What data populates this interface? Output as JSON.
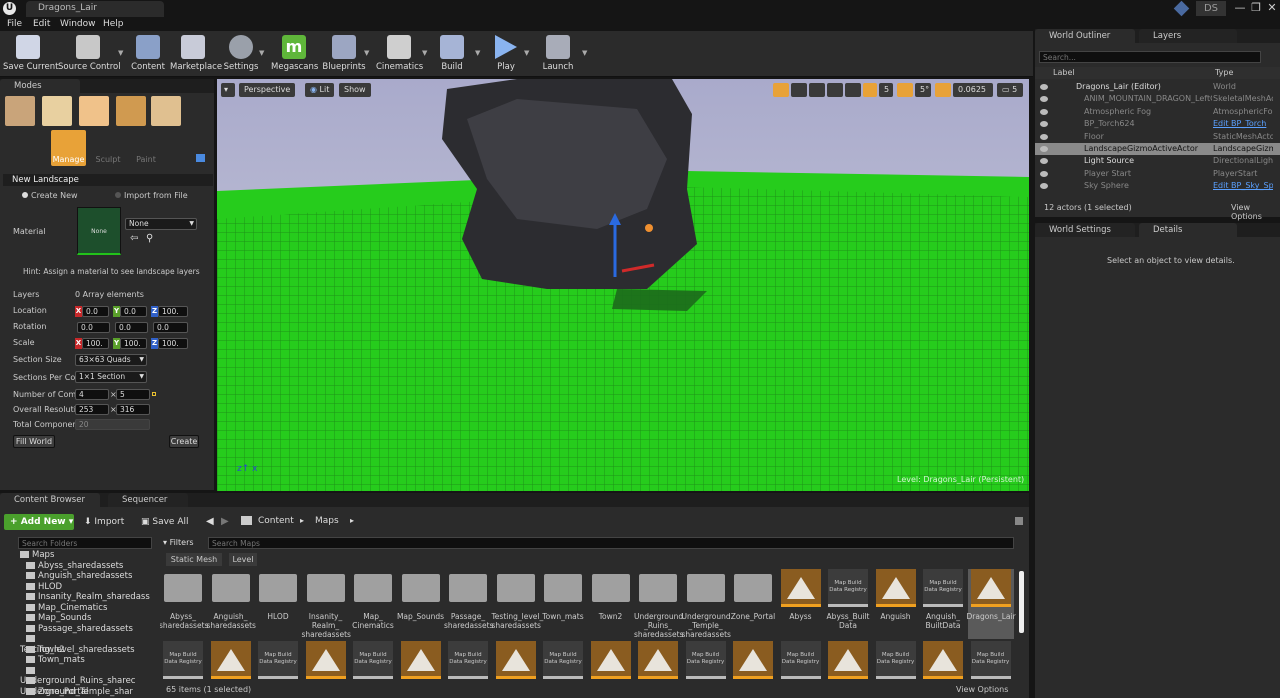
{
  "app": {
    "window_title": "Dragons_Lair",
    "logo_text": "U",
    "user_badge": "DS",
    "window_buttons": [
      "—",
      "❐",
      "✕"
    ]
  },
  "menu": [
    "File",
    "Edit",
    "Window",
    "Help"
  ],
  "toolbar": [
    {
      "label": "Save Current",
      "icon": "save-icon",
      "color": "#d0d6e6"
    },
    {
      "label": "Source Control",
      "icon": "source-control-icon",
      "color": "#c8c8c8"
    },
    {
      "label": "Content",
      "icon": "content-icon",
      "color": "#8aa0c8"
    },
    {
      "label": "Marketplace",
      "icon": "marketplace-icon",
      "color": "#c8cbd8"
    },
    {
      "label": "Settings",
      "icon": "gear-icon",
      "color": "#9aa0aa"
    },
    {
      "label": "Megascans",
      "icon": "megascans-icon",
      "color": "#5fb63a"
    },
    {
      "label": "Blueprints",
      "icon": "blueprints-icon",
      "color": "#9ca6c2"
    },
    {
      "label": "Cinematics",
      "icon": "cinematics-icon",
      "color": "#cfcfcf"
    },
    {
      "label": "Build",
      "icon": "build-icon",
      "color": "#a6b4d6"
    },
    {
      "label": "Play",
      "icon": "play-icon",
      "color": "#8ab4f0"
    },
    {
      "label": "Launch",
      "icon": "launch-icon",
      "color": "#a8acb8"
    }
  ],
  "modes": {
    "tab_label": "Modes",
    "tools": [
      "Manage",
      "Sculpt",
      "Paint"
    ],
    "section_title": "New Landscape",
    "radio_create": "Create New",
    "radio_import": "Import from File",
    "material_label": "Material",
    "material_thumb": "None",
    "material_value": "None",
    "hint": "Hint: Assign a material to see landscape layers",
    "layers_label": "Layers",
    "layers_value": "0 Array elements",
    "location_label": "Location",
    "location": [
      "0.0",
      "0.0",
      "100."
    ],
    "rotation_label": "Rotation",
    "rotation": [
      "0.0",
      "0.0",
      "0.0"
    ],
    "scale_label": "Scale",
    "scale": [
      "100.",
      "100.",
      "100."
    ],
    "axes": [
      "X",
      "Y",
      "Z"
    ],
    "section_size_label": "Section Size",
    "section_size": "63×63 Quads",
    "sections_per_label": "Sections Per Con",
    "sections_per": "1×1 Section",
    "num_comp_label": "Number of Comp",
    "num_comp": [
      "4",
      "5"
    ],
    "overall_res_label": "Overall Resoluti",
    "overall_res": [
      "253",
      "316"
    ],
    "total_comp_label": "Total Componen",
    "total_comp": "20",
    "fill_world": "Fill World",
    "create": "Create"
  },
  "viewport": {
    "perspective": "Perspective",
    "lit": "Lit",
    "show": "Show",
    "grid_value": "5°",
    "snap_value": "0.0625",
    "camera_speed": "5",
    "level_label": "Level:  Dragons_Lair (Persistent)"
  },
  "outliner": {
    "tab_outliner": "World Outliner",
    "tab_layers": "Layers",
    "search_placeholder": "Search...",
    "col_label": "Label",
    "col_type": "Type",
    "rows": [
      {
        "label": "Dragons_Lair (Editor)",
        "type": "World",
        "selected": false,
        "link": false
      },
      {
        "label": "ANIM_MOUNTAIN_DRAGON_LeftCl",
        "type": "SkeletalMeshActo",
        "selected": false,
        "link": false
      },
      {
        "label": "Atmospheric Fog",
        "type": "AtmosphericFog",
        "selected": false,
        "link": false
      },
      {
        "label": "BP_Torch624",
        "type": "Edit BP_Torch",
        "selected": false,
        "link": true
      },
      {
        "label": "Floor",
        "type": "StaticMeshActor",
        "selected": false,
        "link": false
      },
      {
        "label": "LandscapeGizmoActiveActor",
        "type": "LandscapeGizmo",
        "selected": true,
        "link": false
      },
      {
        "label": "Light Source",
        "type": "DirectionalLight",
        "selected": false,
        "link": false
      },
      {
        "label": "Player Start",
        "type": "PlayerStart",
        "selected": false,
        "link": false
      },
      {
        "label": "Sky Sphere",
        "type": "Edit BP_Sky_Sph",
        "selected": false,
        "link": true
      }
    ],
    "status": "12 actors (1 selected)",
    "view_options": "View Options"
  },
  "details": {
    "tab_settings": "World Settings",
    "tab_details": "Details",
    "empty_msg": "Select an object to view details."
  },
  "content_browser": {
    "tab_cb": "Content Browser",
    "tab_seq": "Sequencer",
    "add_new": "Add New",
    "import": "Import",
    "save_all": "Save All",
    "path": [
      "Content",
      "Maps"
    ],
    "search_folders": "Search Folders",
    "filters": "Filters",
    "search_maps": "Search Maps",
    "filter_chips": [
      "Static Mesh",
      "Level"
    ],
    "tree": [
      "Maps",
      "Abyss_sharedassets",
      "Anguish_sharedassets",
      "HLOD",
      "Insanity_Realm_sharedass",
      "Map_Cinematics",
      "Map_Sounds",
      "Passage_sharedassets",
      "Testing_level_sharedassets",
      "Town2",
      "Town_mats",
      "Underground_Ruins_sharec",
      "Underground_Temple_shar",
      "Zone_Portal"
    ],
    "assets_row1": [
      {
        "name": "Abyss_ sharedassets",
        "kind": "folder"
      },
      {
        "name": "Anguish_ sharedassets",
        "kind": "folder"
      },
      {
        "name": "HLOD",
        "kind": "folder"
      },
      {
        "name": "Insanity_ Realm_ sharedassets",
        "kind": "folder"
      },
      {
        "name": "Map_ Cinematics",
        "kind": "folder"
      },
      {
        "name": "Map_Sounds",
        "kind": "folder"
      },
      {
        "name": "Passage_ sharedassets",
        "kind": "folder"
      },
      {
        "name": "Testing_level_ sharedassets",
        "kind": "folder"
      },
      {
        "name": "Town_mats",
        "kind": "folder"
      },
      {
        "name": "Town2",
        "kind": "folder"
      },
      {
        "name": "Underground _Ruins_ sharedassets",
        "kind": "folder"
      },
      {
        "name": "Underground _Temple_ sharedassets",
        "kind": "folder"
      },
      {
        "name": "Zone_Portal",
        "kind": "folder"
      },
      {
        "name": "Abyss",
        "kind": "level"
      },
      {
        "name": "Abyss_Built Data",
        "kind": "data"
      },
      {
        "name": "Anguish",
        "kind": "level"
      },
      {
        "name": "Anguish_ BuiltData",
        "kind": "data"
      },
      {
        "name": "Dragons_Lair",
        "kind": "level"
      }
    ],
    "row2_kinds": [
      "data",
      "level",
      "data",
      "level",
      "data",
      "level",
      "data",
      "level",
      "data",
      "level",
      "level",
      "data",
      "level",
      "data",
      "level",
      "data",
      "level",
      "data"
    ],
    "data_thumb_text": "Map Build Data Registry",
    "status": "65 items (1 selected)",
    "view_options": "View Options"
  },
  "colors": {
    "accent": "#f0a020",
    "selection": "#e8b000",
    "add_new_green": "#4aa02c",
    "landscape_green": "#22c21a",
    "link_blue": "#5aa0ff"
  }
}
